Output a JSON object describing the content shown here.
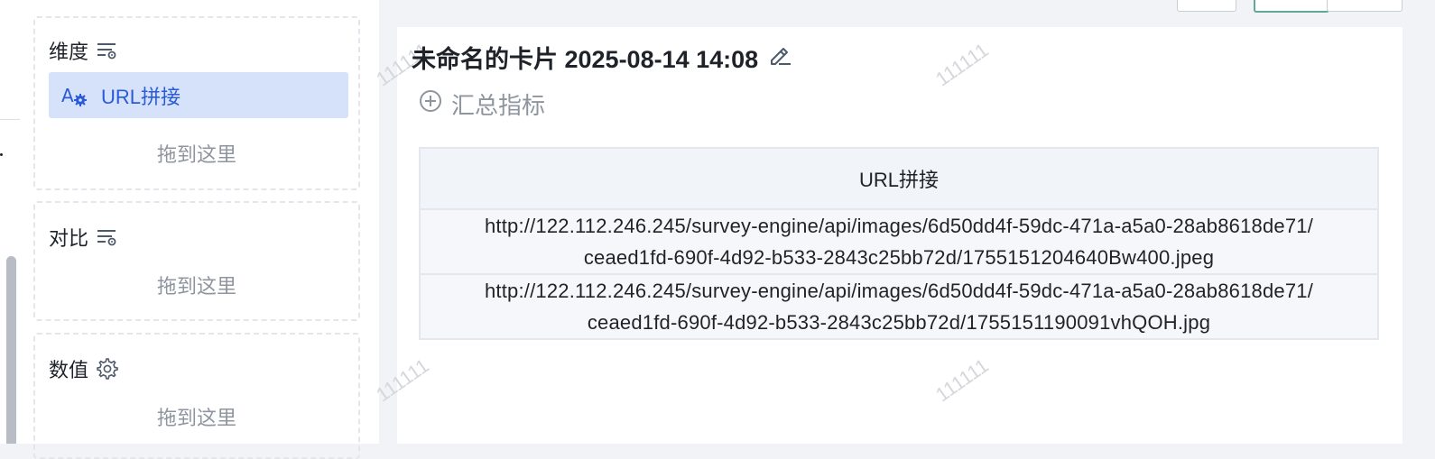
{
  "config": {
    "dimension": {
      "label": "维度",
      "chip_label": "URL拼接",
      "drop_hint": "拖到这里"
    },
    "comparison": {
      "label": "对比",
      "drop_hint": "拖到这里"
    },
    "values": {
      "label": "数值",
      "drop_hint": "拖到这里"
    }
  },
  "card": {
    "title": "未命名的卡片 2025-08-14 14:08",
    "add_metric_label": "汇总指标",
    "watermark": "111111",
    "table": {
      "header": "URL拼接",
      "rows": [
        {
          "line1": "http://122.112.246.245/survey-engine/api/images/6d50dd4f-59dc-471a-a5a0-28ab8618de71/",
          "line2": "ceaed1fd-690f-4d92-b533-2843c25bb72d/1755151204640Bw400.jpeg"
        },
        {
          "line1": "http://122.112.246.245/survey-engine/api/images/6d50dd4f-59dc-471a-a5a0-28ab8618de71/",
          "line2": "ceaed1fd-690f-4d92-b533-2843c25bb72d/1755151190091vhQOH.jpg"
        }
      ]
    }
  },
  "icons": {
    "filter": "filter-settings-icon",
    "gear": "gear-icon",
    "edit": "pencil-edit-icon",
    "add": "plus-circle-icon",
    "field_type": "text-field-settings-icon"
  },
  "colors": {
    "accent": "#2a5bd7",
    "chip_bg": "#d6e2fa",
    "muted": "#8f959e"
  }
}
